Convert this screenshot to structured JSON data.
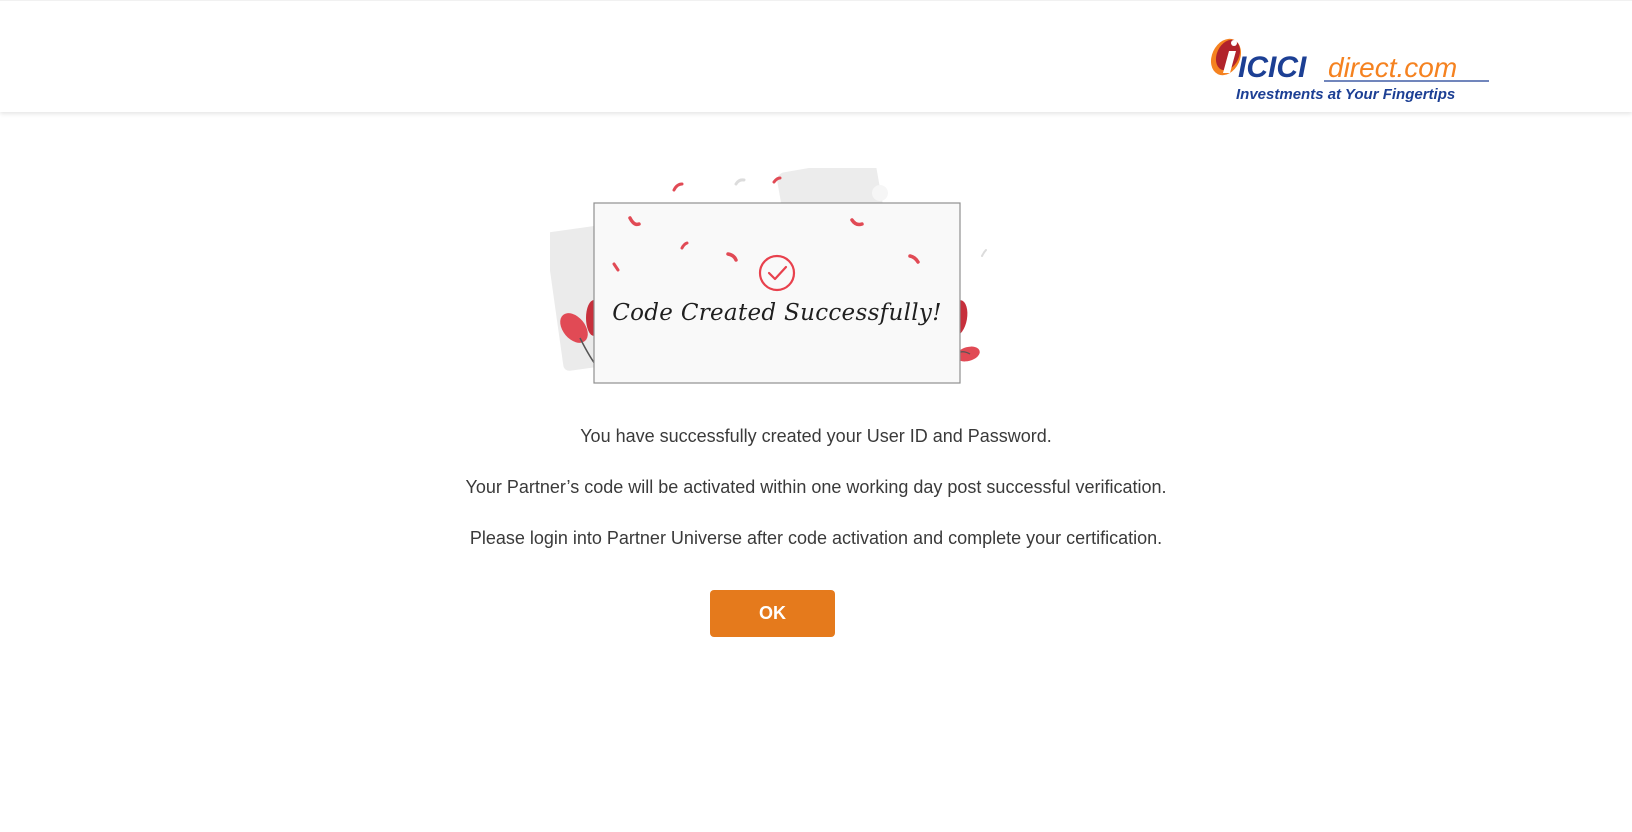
{
  "header": {
    "logo": {
      "brand_text": "ICICI",
      "domain_text": "direct.com",
      "tagline": "Investments at Your Fingertips",
      "icon": "icici-i-logo-icon",
      "brand_color": "#1c3f94",
      "accent_color": "#f58220"
    }
  },
  "success_card": {
    "title": "Code Created Successfully!",
    "icon": "check-circle-icon",
    "icon_color": "#e8414d"
  },
  "messages": {
    "line1": "You have successfully created your User ID and Password.",
    "line2": "Your Partner’s code will be activated within one working day post successful verification.",
    "line3": "Please login into Partner Universe after code activation and complete your certification."
  },
  "actions": {
    "ok_label": "OK",
    "ok_color": "#e57a1c"
  }
}
